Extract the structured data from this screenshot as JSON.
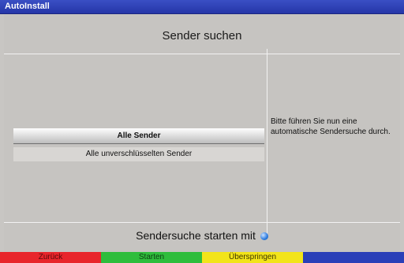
{
  "window": {
    "title": "AutoInstall"
  },
  "header": {
    "title": "Sender suchen"
  },
  "menu": {
    "items": [
      {
        "label": "Alle Sender",
        "selected": true
      },
      {
        "label": "Alle unverschlüsselten Sender",
        "selected": false
      }
    ]
  },
  "info": {
    "text": "Bitte führen Sie nun eine automatische Sendersuche durch."
  },
  "footer": {
    "text": "Sendersuche starten mit",
    "icon": "blue-button-icon"
  },
  "color_buttons": [
    {
      "label": "Zurück",
      "color": "#e8252b"
    },
    {
      "label": "Starten",
      "color": "#2fbd3c"
    },
    {
      "label": "Überspringen",
      "color": "#f2e41a"
    },
    {
      "label": "",
      "color": "#2a3fb8"
    }
  ]
}
